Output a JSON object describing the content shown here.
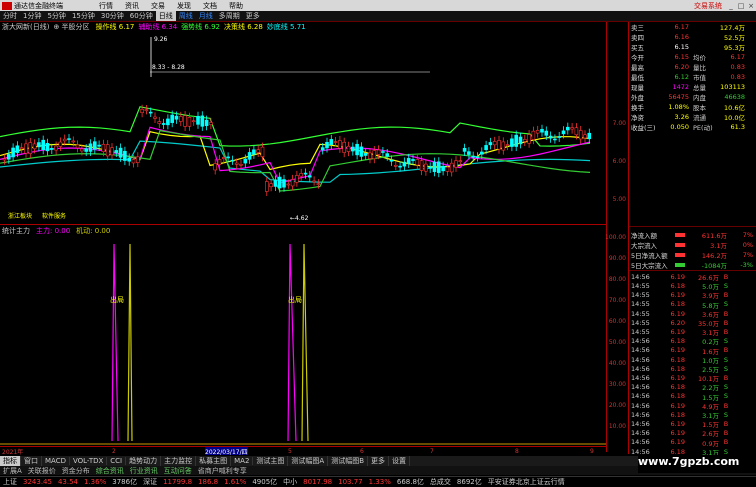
{
  "titlebar": {
    "app": "通达信金融终端",
    "menus": [
      "行情",
      "资讯",
      "交易",
      "发现",
      "文档",
      "帮助"
    ],
    "right": "交易系统",
    "ctrls": [
      "_",
      "□",
      "×"
    ]
  },
  "periods": {
    "items": [
      "分时",
      "1分钟",
      "5分钟",
      "15分钟",
      "30分钟",
      "60分钟",
      "日线",
      "周线",
      "月线",
      "多周期",
      "更多"
    ],
    "selected": "日线",
    "highlight": [
      "周线",
      "月线"
    ]
  },
  "indline": {
    "stock": "浙大网新(日线)",
    "mode": "⊕ 半股分区",
    "items": [
      {
        "label": "操作线",
        "value": "6.17",
        "color": "#ff0"
      },
      {
        "label": "辅助线",
        "value": "6.34",
        "color": "#f0f"
      },
      {
        "label": "强势线",
        "value": "6.92",
        "color": "#3f3"
      },
      {
        "label": "决策线",
        "value": "6.28",
        "color": "#ff0"
      },
      {
        "label": "妙底线",
        "value": "5.71",
        "color": "#0ff"
      }
    ]
  },
  "annot": {
    "high": "9.26",
    "range": "8.33 - 8.28",
    "low": "←4.62",
    "board1": "浙江板块",
    "board2": "软件服务"
  },
  "sub": {
    "name": "统计主力",
    "value": "主力: 0.00",
    "aux": "机动: 0.00",
    "signal": "出局"
  },
  "axis": {
    "main": [
      "7.00",
      "6.00",
      "5.00"
    ],
    "sub": [
      "100.00",
      "90.00",
      "80.00",
      "70.00",
      "60.00",
      "50.00",
      "40.00",
      "30.00",
      "20.00",
      "10.00"
    ]
  },
  "dates": {
    "items": [
      "2021年",
      "2",
      "3",
      "2022/03/17/四",
      "5",
      "6",
      "7",
      "8",
      "9"
    ],
    "selected": "2022/03/17/四"
  },
  "indtabs": {
    "items": [
      "指标",
      "窗口",
      "MACD",
      "VOL-TDX",
      "CCI",
      "趋势动力",
      "主力监控",
      "私募主图",
      "MA2",
      "测试主图",
      "测试幅图A",
      "测试幅图B",
      "更多",
      "设置"
    ],
    "selected": "指标"
  },
  "funtabs": {
    "items": [
      "扩展A",
      "关联报价",
      "资金分布",
      "综合资讯",
      "行业资讯",
      "互动问答",
      "省商户喊利专享"
    ],
    "green": [
      "综合资讯",
      "行业资讯",
      "互动问答"
    ]
  },
  "status": [
    {
      "t": "上证",
      "c": "#ccc"
    },
    {
      "t": "3243.45",
      "c": "#f33"
    },
    {
      "t": "43.54",
      "c": "#f33"
    },
    {
      "t": "1.36%",
      "c": "#f33"
    },
    {
      "t": "3786亿",
      "c": "#ccc"
    },
    {
      "t": "深证",
      "c": "#ccc"
    },
    {
      "t": "11799.8",
      "c": "#f33"
    },
    {
      "t": "186.8",
      "c": "#f33"
    },
    {
      "t": "1.61%",
      "c": "#f33"
    },
    {
      "t": "4905亿",
      "c": "#ccc"
    },
    {
      "t": "中小",
      "c": "#ccc"
    },
    {
      "t": "8017.98",
      "c": "#f33"
    },
    {
      "t": "103.77",
      "c": "#f33"
    },
    {
      "t": "1.33%",
      "c": "#f33"
    },
    {
      "t": "668.8亿",
      "c": "#ccc"
    },
    {
      "t": "总成交",
      "c": "#ccc"
    },
    {
      "t": "8692亿",
      "c": "#ccc"
    },
    {
      "t": "平安证券北京上证云行情",
      "c": "#ccc"
    }
  ],
  "quote": [
    {
      "l": "卖三",
      "v": "6.17",
      "vc": "red",
      "r": "127.4万",
      "rc": "yel"
    },
    {
      "l": "卖四",
      "v": "6.16",
      "vc": "red",
      "r": "52.5万",
      "rc": "yel"
    },
    {
      "l": "买五",
      "v": "6.15",
      "vc": "wh",
      "r": "95.3万",
      "rc": "yel"
    },
    {
      "l": "今开",
      "v": "6.15",
      "vc": "red",
      "l2": "均价",
      "v2": "6.17",
      "v2c": "red"
    },
    {
      "l": "最高",
      "v": "6.20",
      "vc": "red",
      "l2": "量比",
      "v2": "0.83",
      "v2c": "red"
    },
    {
      "l": "最低",
      "v": "6.12",
      "vc": "grn",
      "l2": "市值",
      "v2": "0.83",
      "v2c": "red"
    },
    {
      "l": "现量",
      "v": "1472",
      "vc": "mag",
      "l2": "总量",
      "v2": "103113",
      "v2c": "yel"
    },
    {
      "l": "外盘",
      "v": "56475",
      "vc": "red",
      "l2": "内盘",
      "v2": "46638",
      "v2c": "grn"
    },
    {
      "l": "换手",
      "v": "1.08%",
      "vc": "yel",
      "l2": "股本",
      "v2": "10.6亿",
      "v2c": "yel"
    },
    {
      "l": "净资",
      "v": "3.26",
      "vc": "yel",
      "l2": "流通",
      "v2": "10.0亿",
      "v2c": "yel"
    },
    {
      "l": "收益(三)",
      "v": "0.050",
      "vc": "yel",
      "l2": "PE(动)",
      "v2": "61.3",
      "v2c": "yel"
    }
  ],
  "flows": [
    {
      "l": "净流入额",
      "v": "611.6万",
      "p": "7%",
      "c": "red"
    },
    {
      "l": "大宗流入",
      "v": "3.1万",
      "p": "0%",
      "c": "red"
    },
    {
      "l": "5日净流入额",
      "v": "146.2万",
      "p": "7%",
      "c": "red"
    },
    {
      "l": "5日大宗流入",
      "v": "-1084万",
      "p": "-3%",
      "c": "grn"
    }
  ],
  "ticks": [
    [
      "14:56",
      "6.19",
      "26.6万",
      "B"
    ],
    [
      "14:55",
      "6.18",
      "5.0万",
      "S"
    ],
    [
      "14:55",
      "6.19",
      "3.9万",
      "B"
    ],
    [
      "14:55",
      "6.18",
      "5.8万",
      "S"
    ],
    [
      "14:55",
      "6.19",
      "3.6万",
      "B"
    ],
    [
      "14:55",
      "6.20",
      "35.0万",
      "B"
    ],
    [
      "14:55",
      "6.19",
      "3.1万",
      "B"
    ],
    [
      "14:56",
      "6.18",
      "0.2万",
      "S"
    ],
    [
      "14:56",
      "6.19",
      "1.6万",
      "B"
    ],
    [
      "14:56",
      "6.18",
      "1.0万",
      "S"
    ],
    [
      "14:56",
      "6.18",
      "2.5万",
      "S"
    ],
    [
      "14:56",
      "6.19",
      "10.1万",
      "B"
    ],
    [
      "14:56",
      "6.18",
      "2.2万",
      "S"
    ],
    [
      "14:56",
      "6.18",
      "1.5万",
      "S"
    ],
    [
      "14:56",
      "6.19",
      "4.9万",
      "B"
    ],
    [
      "14:56",
      "6.18",
      "3.1万",
      "S"
    ],
    [
      "14:56",
      "6.19",
      "1.5万",
      "B"
    ],
    [
      "14:56",
      "6.19",
      "2.6万",
      "B"
    ],
    [
      "14:56",
      "6.19",
      "0.9万",
      "B"
    ],
    [
      "14:56",
      "6.18",
      "3.1万",
      "S"
    ]
  ],
  "watermark": "www.7gpzb.com"
}
